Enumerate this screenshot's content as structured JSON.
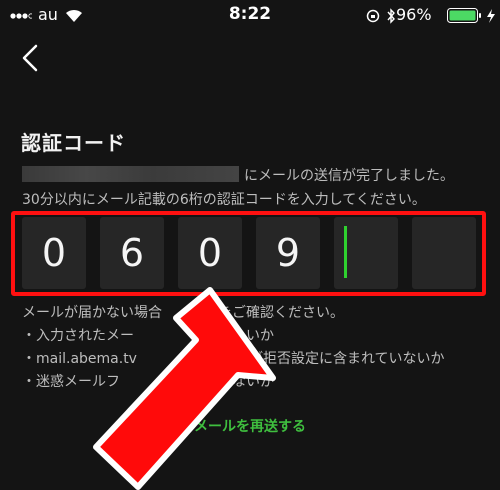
{
  "status_bar": {
    "carrier": "au",
    "time": "8:22",
    "battery_percent": "96%"
  },
  "page": {
    "title": "認証コード",
    "sent_message": "にメールの送信が完了しました。",
    "instruction": "30分以内にメール記載の6桁の認証コードを入力してください。"
  },
  "code": {
    "digits": [
      "0",
      "6",
      "0",
      "9",
      "",
      ""
    ]
  },
  "help": {
    "title": "メールが届かない場合　　　　をご確認ください。",
    "items": [
      "・入力されたメー　　　　　が正しいか",
      "・mail.abema.tv　　　　アドレスが拒否設定に含まれていないか",
      "・迷惑メールフ　　　　　　ていないか"
    ]
  },
  "actions": {
    "resend": "メールを再送する"
  },
  "colors": {
    "background": "#141414",
    "accent_green": "#3fbf3f",
    "highlight_red": "#ff1010"
  }
}
